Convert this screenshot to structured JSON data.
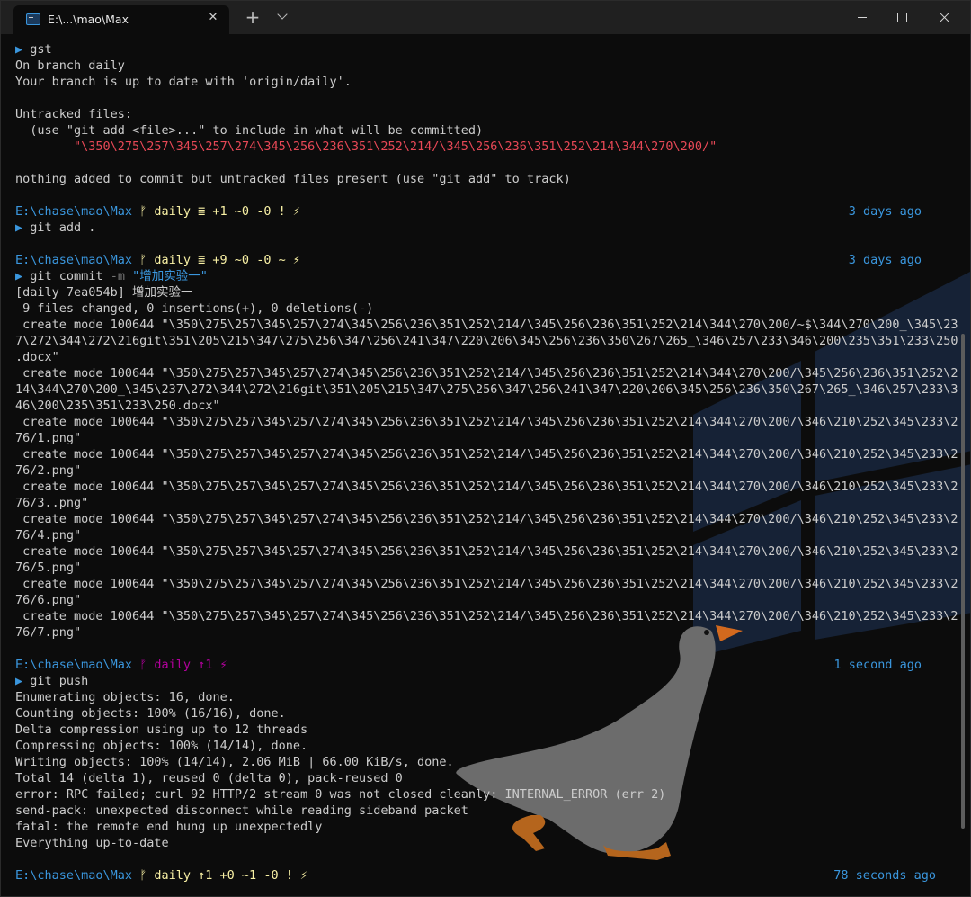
{
  "tab": {
    "title": "E:\\...\\mao\\Max",
    "close": "✕"
  },
  "titlebar": {
    "new_tab": "+"
  },
  "colors": {
    "background": "#0c0c0c",
    "text": "#cccccc",
    "blue": "#3a96dd",
    "red": "#e74856",
    "yellow": "#f9f1a5",
    "magenta": "#b4009e"
  },
  "terminal": {
    "b1": {
      "arrow": "▶",
      "cmd": "gst",
      "out": [
        "On branch daily",
        "Your branch is up to date with 'origin/daily'.",
        "",
        "Untracked files:",
        "  (use \"git add <file>...\" to include in what will be committed)"
      ],
      "untracked": "        \"\\350\\275\\257\\345\\257\\274\\345\\256\\236\\351\\252\\214/\\345\\256\\236\\351\\252\\214\\344\\270\\200/\"",
      "tail": "nothing added to commit but untracked files present (use \"git add\" to track)"
    },
    "p1": {
      "path": "E:\\chase\\mao\\Max",
      "branch": " ᚠ daily ≣ +1 ~0 -0 ! ⚡",
      "time": "3 days ago"
    },
    "c2": {
      "arrow": "▶",
      "cmd": "git add ."
    },
    "p2": {
      "path": "E:\\chase\\mao\\Max",
      "branch": " ᚠ daily ≣ +9 ~0 -0 ~ ⚡",
      "time": "3 days ago"
    },
    "c3": {
      "arrow": "▶",
      "cmd": "git commit",
      "flag": "-m",
      "msg": "\"增加实验一\""
    },
    "commit_out": [
      "[daily 7ea054b] 增加实验一",
      " 9 files changed, 0 insertions(+), 0 deletions(-)",
      " create mode 100644 \"\\350\\275\\257\\345\\257\\274\\345\\256\\236\\351\\252\\214/\\345\\256\\236\\351\\252\\214\\344\\270\\200/~$\\344\\270\\200_\\345\\23",
      "7\\272\\344\\272\\216git\\351\\205\\215\\347\\275\\256\\347\\256\\241\\347\\220\\206\\345\\256\\236\\350\\267\\265_\\346\\257\\233\\346\\200\\235\\351\\233\\250",
      ".docx\"",
      " create mode 100644 \"\\350\\275\\257\\345\\257\\274\\345\\256\\236\\351\\252\\214/\\345\\256\\236\\351\\252\\214\\344\\270\\200/\\345\\256\\236\\351\\252\\2",
      "14\\344\\270\\200_\\345\\237\\272\\344\\272\\216git\\351\\205\\215\\347\\275\\256\\347\\256\\241\\347\\220\\206\\345\\256\\236\\350\\267\\265_\\346\\257\\233\\3",
      "46\\200\\235\\351\\233\\250.docx\"",
      " create mode 100644 \"\\350\\275\\257\\345\\257\\274\\345\\256\\236\\351\\252\\214/\\345\\256\\236\\351\\252\\214\\344\\270\\200/\\346\\210\\252\\345\\233\\2",
      "76/1.png\"",
      " create mode 100644 \"\\350\\275\\257\\345\\257\\274\\345\\256\\236\\351\\252\\214/\\345\\256\\236\\351\\252\\214\\344\\270\\200/\\346\\210\\252\\345\\233\\2",
      "76/2.png\"",
      " create mode 100644 \"\\350\\275\\257\\345\\257\\274\\345\\256\\236\\351\\252\\214/\\345\\256\\236\\351\\252\\214\\344\\270\\200/\\346\\210\\252\\345\\233\\2",
      "76/3..png\"",
      " create mode 100644 \"\\350\\275\\257\\345\\257\\274\\345\\256\\236\\351\\252\\214/\\345\\256\\236\\351\\252\\214\\344\\270\\200/\\346\\210\\252\\345\\233\\2",
      "76/4.png\"",
      " create mode 100644 \"\\350\\275\\257\\345\\257\\274\\345\\256\\236\\351\\252\\214/\\345\\256\\236\\351\\252\\214\\344\\270\\200/\\346\\210\\252\\345\\233\\2",
      "76/5.png\"",
      " create mode 100644 \"\\350\\275\\257\\345\\257\\274\\345\\256\\236\\351\\252\\214/\\345\\256\\236\\351\\252\\214\\344\\270\\200/\\346\\210\\252\\345\\233\\2",
      "76/6.png\"",
      " create mode 100644 \"\\350\\275\\257\\345\\257\\274\\345\\256\\236\\351\\252\\214/\\345\\256\\236\\351\\252\\214\\344\\270\\200/\\346\\210\\252\\345\\233\\2",
      "76/7.png\""
    ],
    "p3": {
      "path": "E:\\chase\\mao\\Max",
      "branch": " ᚠ daily ↑1 ⚡",
      "time": "1 second ago"
    },
    "c4": {
      "arrow": "▶",
      "cmd": "git push"
    },
    "push_out": [
      "Enumerating objects: 16, done.",
      "Counting objects: 100% (16/16), done.",
      "Delta compression using up to 12 threads",
      "Compressing objects: 100% (14/14), done.",
      "Writing objects: 100% (14/14), 2.06 MiB | 66.00 KiB/s, done.",
      "Total 14 (delta 1), reused 0 (delta 0), pack-reused 0",
      "error: RPC failed; curl 92 HTTP/2 stream 0 was not closed cleanly: INTERNAL_ERROR (err 2)",
      "send-pack: unexpected disconnect while reading sideband packet",
      "fatal: the remote end hung up unexpectedly",
      "Everything up-to-date"
    ],
    "p4": {
      "path": "E:\\chase\\mao\\Max",
      "branch": " ᚠ daily ↑1 +0 ~1 -0 ! ⚡",
      "time": "78 seconds ago"
    }
  }
}
